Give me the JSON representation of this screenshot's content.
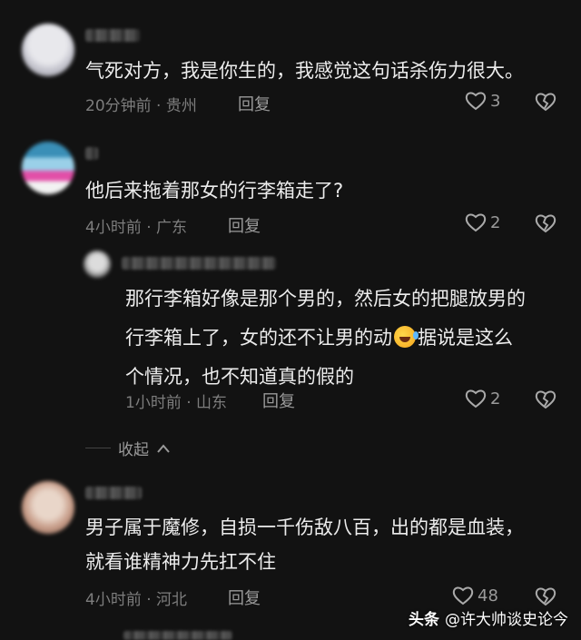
{
  "comments": [
    {
      "content": "气死对方，我是你生的，我感觉这句话杀伤力很大。",
      "meta": "20分钟前 · 贵州",
      "reply_label": "回复",
      "likes": "3"
    },
    {
      "content": "他后来拖着那女的行李箱走了?",
      "meta": "4小时前 · 广东",
      "reply_label": "回复",
      "likes": "2"
    },
    {
      "content_lines": [
        "那行李箱好像是那个男的，然后女的把腿放男的",
        "行李箱上了，女的还不让男的动",
        "据说是这么",
        "个情况，也不知道真的假的"
      ],
      "meta": "1小时前 · 山东",
      "reply_label": "回复",
      "likes": "2"
    },
    {
      "content_lines": [
        "男子属于魔修，自损一千伤敌八百，出的都是血装，",
        "就看谁精神力先扛不住"
      ],
      "meta": "4小时前 · 河北",
      "reply_label": "回复",
      "likes": "48"
    }
  ],
  "collapse_label": "收起",
  "watermark": {
    "brand": "头条",
    "account": "@许大帅谈史论今"
  },
  "icons": {
    "like": "heart-outline-icon",
    "dislike": "broken-heart-icon",
    "collapse": "chevron-up-icon"
  }
}
